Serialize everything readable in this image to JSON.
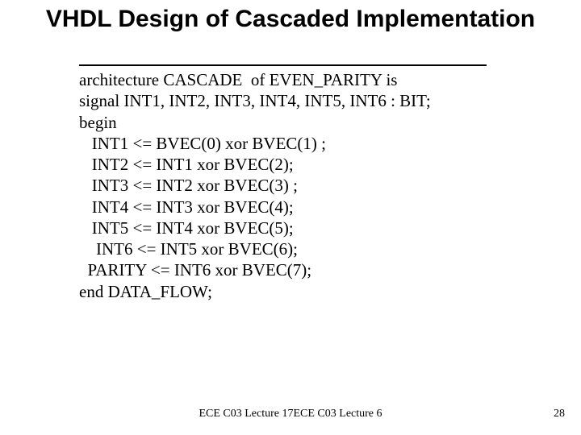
{
  "title": "VHDL Design of Cascaded Implementation",
  "code": {
    "line1": "architecture CASCADE  of EVEN_PARITY is",
    "line2": "signal INT1, INT2, INT3, INT4, INT5, INT6 : BIT;",
    "line3": "begin",
    "line4": "   INT1 <= BVEC(0) xor BVEC(1) ;",
    "line5": "   INT2 <= INT1 xor BVEC(2);",
    "line6": "   INT3 <= INT2 xor BVEC(3) ;",
    "line7": "   INT4 <= INT3 xor BVEC(4);",
    "line8": "   INT5 <= INT4 xor BVEC(5);",
    "line9": "    INT6 <= INT5 xor BVEC(6);",
    "line10": "  PARITY <= INT6 xor BVEC(7);",
    "line11": "end DATA_FLOW;"
  },
  "footer": "ECE C03 Lecture 17ECE C03 Lecture 6",
  "page": "28"
}
